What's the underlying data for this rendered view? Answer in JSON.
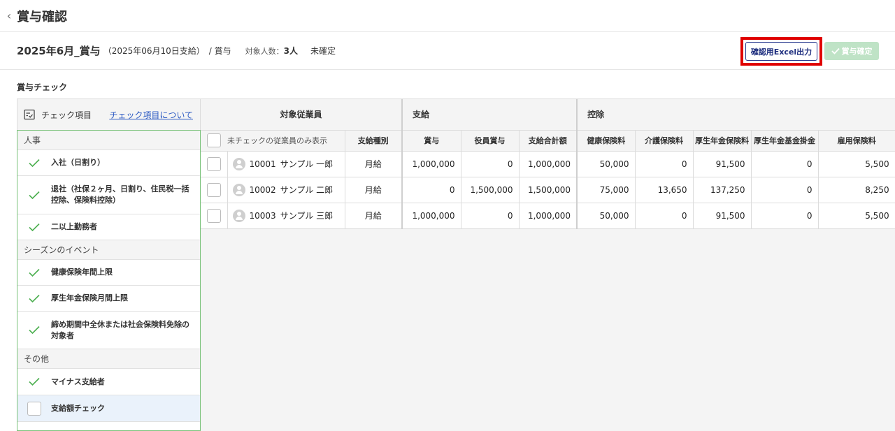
{
  "header": {
    "back_icon": "chevron-left-icon",
    "title": "賞与確認"
  },
  "bonus": {
    "title": "2025年6月_賞与",
    "date": "（2025年06月10日支給）",
    "type": "/ 賞与",
    "target_label": "対象人数：",
    "target_count": "3人",
    "status": "未確定"
  },
  "buttons": {
    "excel": "確認用Excel出力",
    "confirm": "賞与確定"
  },
  "section_title": "賞与チェック",
  "check_panel": {
    "header_label": "チェック項目",
    "header_link": "チェック項目について",
    "categories": [
      {
        "name": "人事",
        "items": [
          {
            "label": "入社（日割り）",
            "checked": true
          },
          {
            "label": "退社（社保２ヶ月、日割り、住民税一括控除、保険料控除）",
            "checked": true
          },
          {
            "label": "二以上勤務者",
            "checked": true
          }
        ]
      },
      {
        "name": "シーズンのイベント",
        "items": [
          {
            "label": "健康保険年間上限",
            "checked": true
          },
          {
            "label": "厚生年金保険月間上限",
            "checked": true
          },
          {
            "label": "締め期間中全休または社会保険料免除の対象者",
            "checked": true
          }
        ]
      },
      {
        "name": "その他",
        "items": [
          {
            "label": "マイナス支給者",
            "checked": true
          },
          {
            "label": "支給額チェック",
            "checked": false
          }
        ]
      }
    ]
  },
  "table": {
    "groups": {
      "employee": "対象従業員",
      "payment": "支給",
      "deduction": "控除"
    },
    "only_unchecked_label": "未チェックの従業員のみ表示",
    "columns": [
      "支給種別",
      "賞与",
      "役員賞与",
      "支給合計額",
      "健康保険料",
      "介護保険料",
      "厚生年金保険料",
      "厚生年金基金掛金",
      "雇用保険料"
    ],
    "rows": [
      {
        "id": "10001",
        "name": "サンプル 一郎",
        "type": "月給",
        "values": [
          "1,000,000",
          "0",
          "1,000,000",
          "50,000",
          "0",
          "91,500",
          "0",
          "5,500"
        ]
      },
      {
        "id": "10002",
        "name": "サンプル 二郎",
        "type": "月給",
        "values": [
          "0",
          "1,500,000",
          "1,500,000",
          "75,000",
          "13,650",
          "137,250",
          "0",
          "8,250"
        ]
      },
      {
        "id": "10003",
        "name": "サンプル 三郎",
        "type": "月給",
        "values": [
          "1,000,000",
          "0",
          "1,000,000",
          "50,000",
          "0",
          "91,500",
          "0",
          "5,500"
        ]
      }
    ]
  },
  "colors": {
    "highlight": "#e00000",
    "check_green": "#4caf50",
    "confirm_disabled": "#bfe3c6",
    "excel_border": "#2a3b8f"
  }
}
